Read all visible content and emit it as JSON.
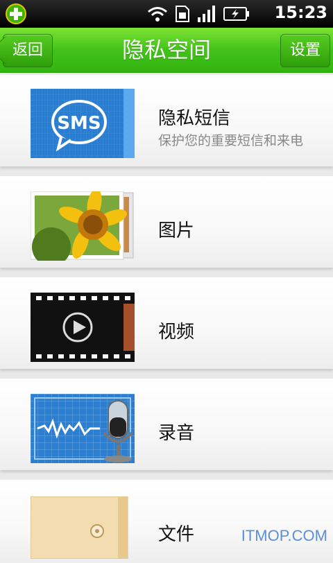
{
  "status": {
    "time": "15:23"
  },
  "header": {
    "back_label": "返回",
    "title": "隐私空间",
    "settings_label": "设置"
  },
  "items": [
    {
      "title": "隐私短信",
      "subtitle": "保护您的重要短信和来电",
      "icon_label": "SMS",
      "icon": "sms-icon"
    },
    {
      "title": "图片",
      "icon": "photo-icon"
    },
    {
      "title": "视频",
      "icon": "video-icon"
    },
    {
      "title": "录音",
      "icon": "recording-icon"
    },
    {
      "title": "文件",
      "icon": "file-icon"
    }
  ],
  "watermark": "ITMOP.COM",
  "colors": {
    "header_green": "#42c219",
    "sms_blue": "#2a7ed1"
  }
}
